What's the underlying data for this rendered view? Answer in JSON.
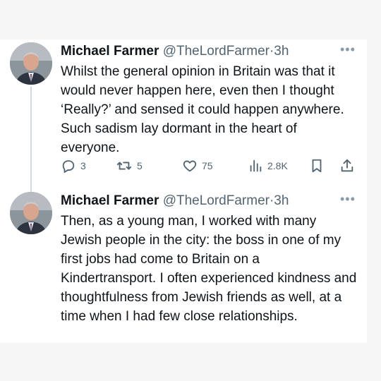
{
  "tweets": [
    {
      "author_name": "Michael Farmer",
      "handle": "@TheLordFarmer",
      "time": "3h",
      "text": "Whilst the general opinion in Britain was that it would never happen here, even then I thought ‘Really?’ and sensed it could happen anywhere. Such sadism lay dormant in the heart of everyone.",
      "replies": "3",
      "retweets": "5",
      "likes": "75",
      "views": "2.8K",
      "more_glyph": "•••"
    },
    {
      "author_name": "Michael Farmer",
      "handle": "@TheLordFarmer",
      "time": "3h",
      "text": "Then, as a young man, I worked with many Jewish people in the city: the boss in one of my first jobs had come to Britain on a Kindertransport. I often experienced kindness and thoughtfulness from Jewish friends as well, at a time when I had few close relationships.",
      "more_glyph": "•••"
    }
  ],
  "separator": "·",
  "colors": {
    "text": "#0f1419",
    "secondary": "#536471",
    "thread_line": "#cfd9de"
  },
  "icons": [
    "reply-icon",
    "retweet-icon",
    "like-icon",
    "views-icon",
    "bookmark-icon",
    "share-icon",
    "more-icon"
  ]
}
